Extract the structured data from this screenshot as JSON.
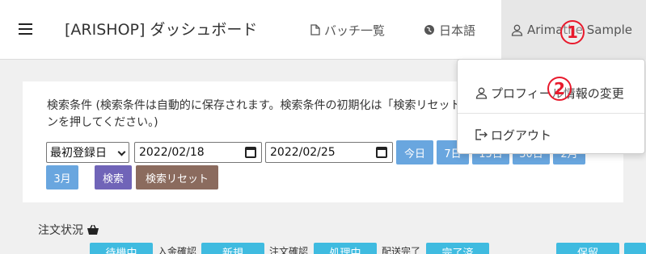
{
  "navbar": {
    "brand": "[ARISHOP] ダッシュボード",
    "batch_label": "バッチ一覧",
    "lang_label": "日本語",
    "user_label": "Arimathe Sample"
  },
  "search": {
    "label": "検索条件 (検索条件は自動的に保存されます。検索条件の初期化は「検索リセット」ボタンを押してください。)",
    "field_select": "最初登録日",
    "date_from": "2022/02/18",
    "date_to": "2022/02/25",
    "buttons": {
      "today": "今日",
      "days7": "7日",
      "days15": "15日",
      "days30": "30日",
      "months2": "2月",
      "months3": "3月",
      "search": "検索",
      "reset": "検索リセット"
    }
  },
  "orders": {
    "title": "注文状況",
    "statuses": [
      "待機中",
      "新規",
      "処理中",
      "完了済",
      "保留"
    ],
    "labels": [
      "入金確認",
      "注文確認",
      "配送完了"
    ]
  },
  "dropdown": {
    "profile": "プロフィール情報の変更",
    "logout": "ログアウト"
  },
  "markers": [
    "1",
    "2"
  ],
  "colors": {
    "accent_blue": "#69a6df",
    "search_purple": "#7064b8",
    "reset_brown": "#8b6b5e",
    "status_cyan": "#3fbbe0",
    "marker_red": "#e8192c"
  }
}
